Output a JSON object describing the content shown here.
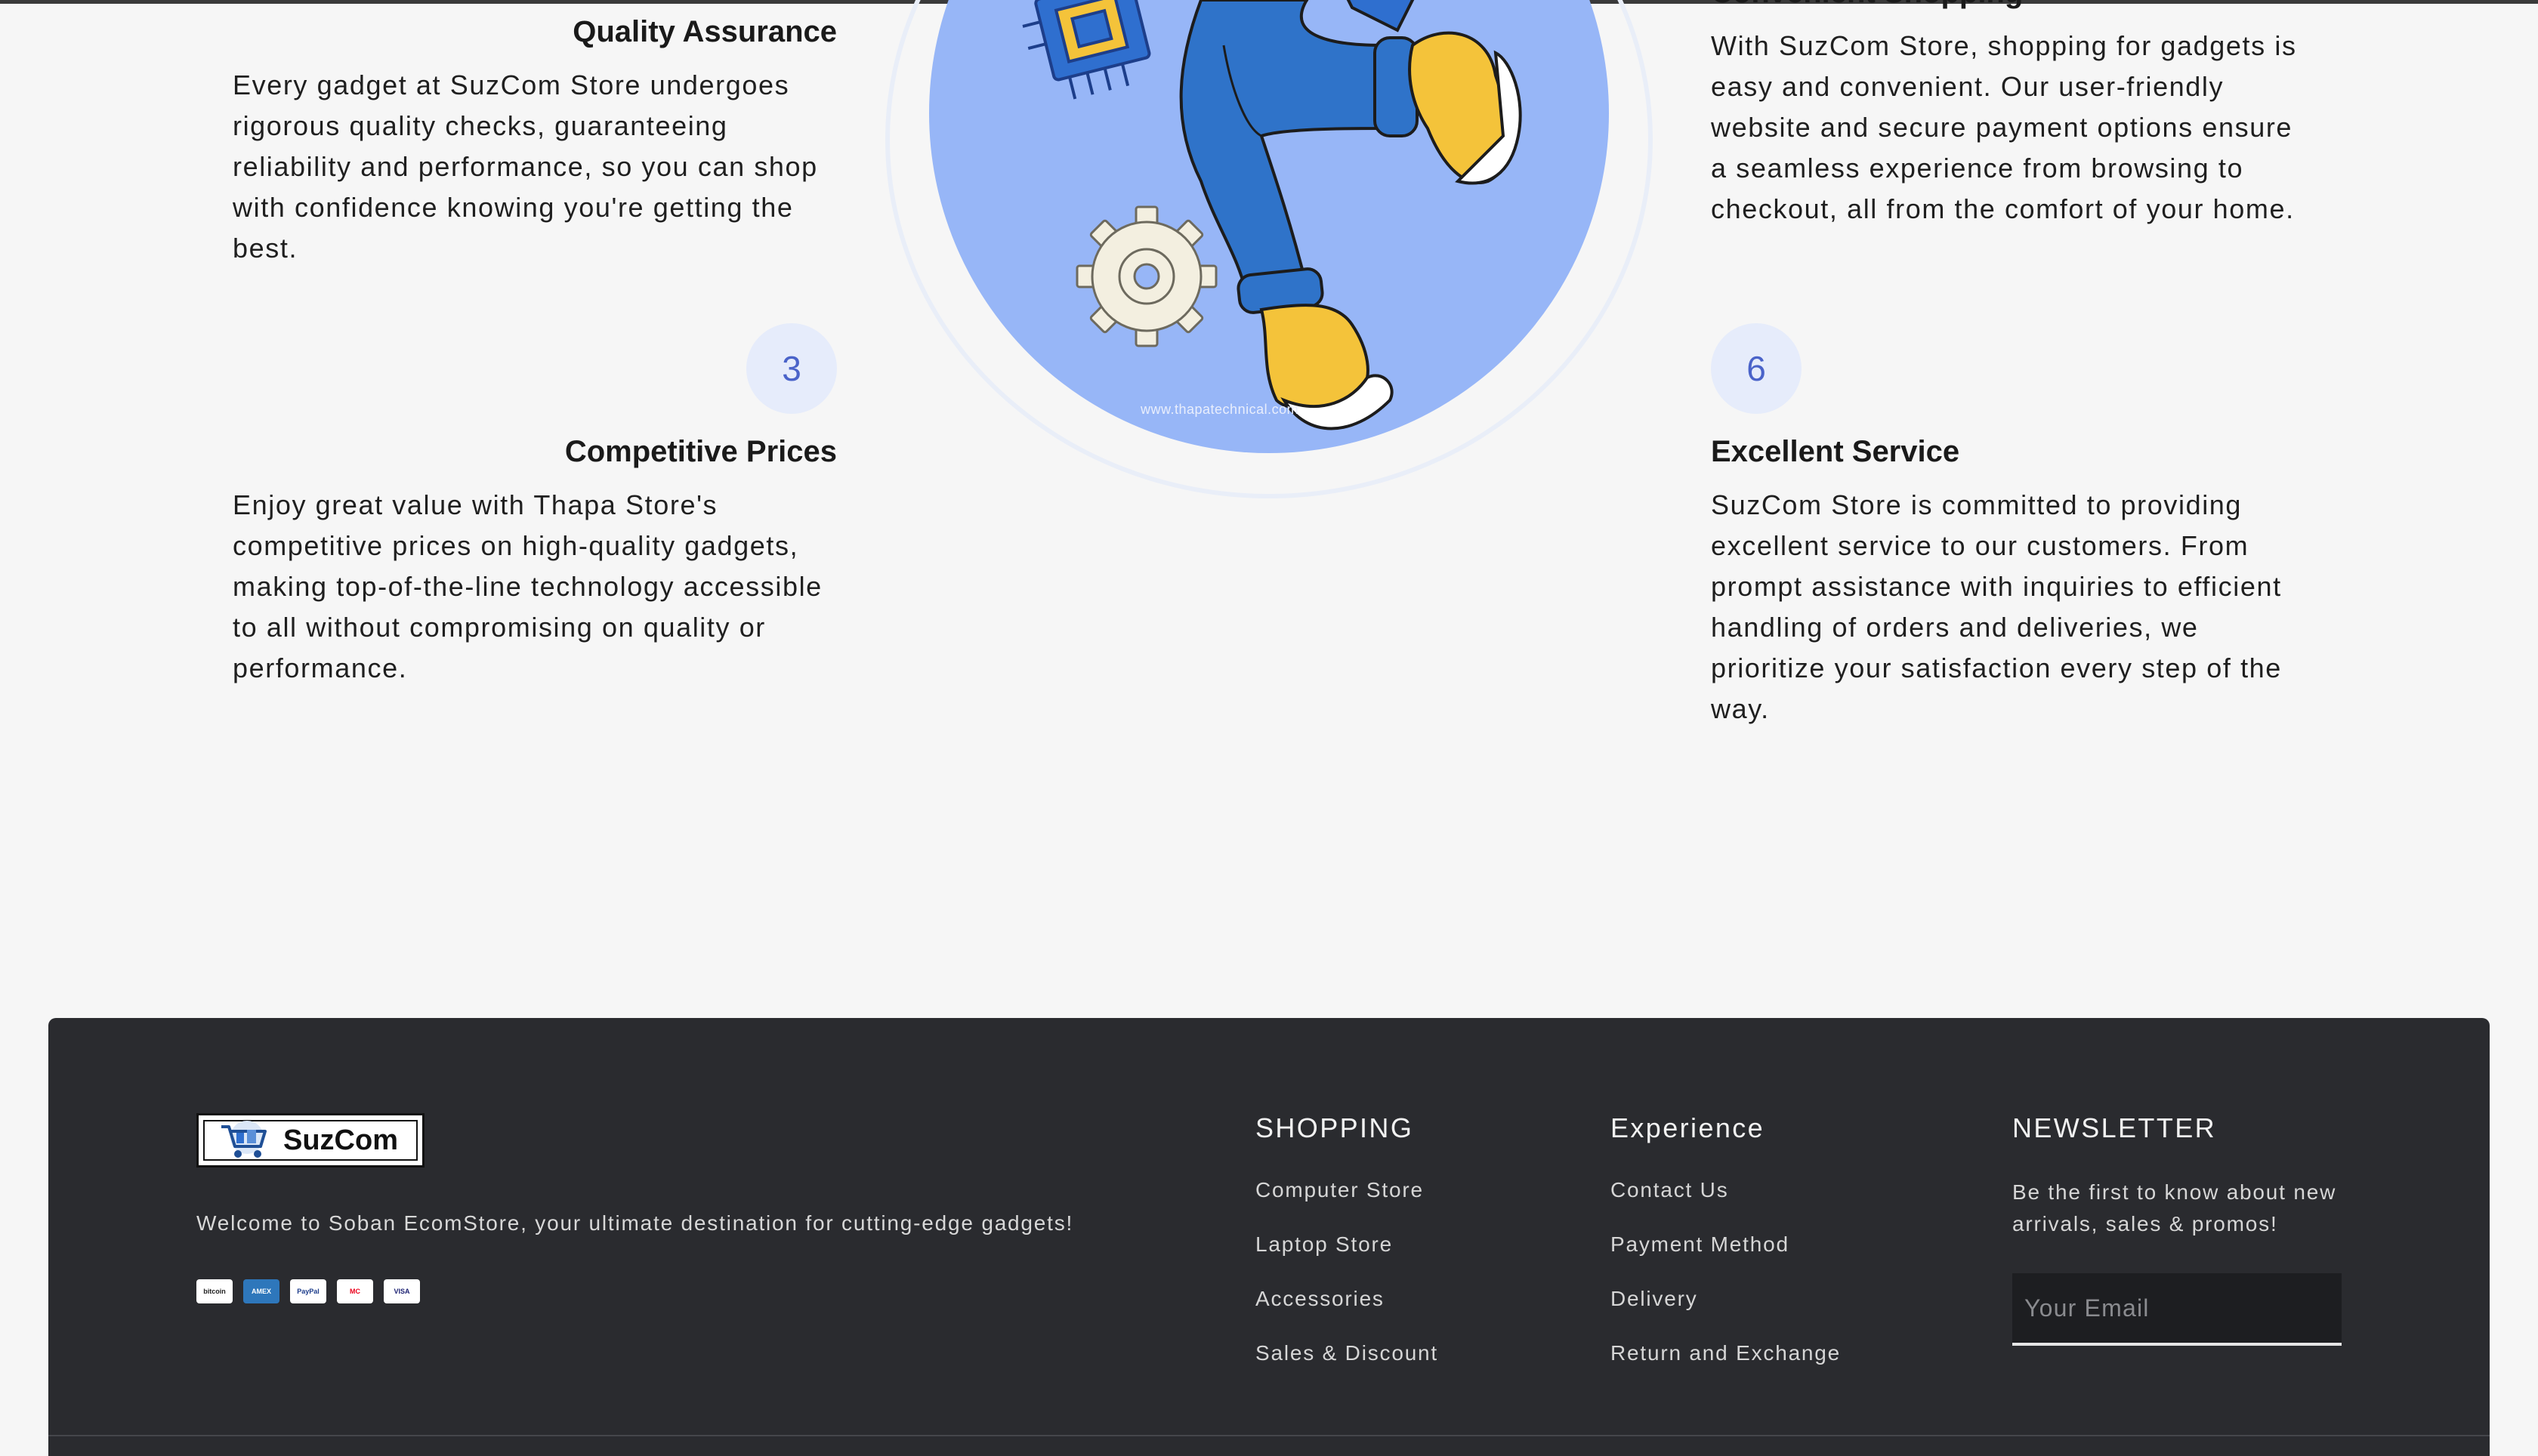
{
  "features": {
    "quality": {
      "title": "Quality Assurance",
      "text": "Every gadget at SuzCom Store undergoes rigorous quality checks, guaranteeing reliability and performance, so you can shop with confidence knowing you're getting the best."
    },
    "prices": {
      "number": "3",
      "title": "Competitive Prices",
      "text": "Enjoy great value with Thapa Store's competitive prices on high-quality gadgets, making top-of-the-line technology accessible to all without compromising on quality or performance."
    },
    "shopping": {
      "title": "Convenient Shopping",
      "text": "With SuzCom Store, shopping for gadgets is easy and convenient. Our user-friendly website and secure payment options ensure a seamless experience from browsing to checkout, all from the comfort of your home."
    },
    "service": {
      "number": "6",
      "title": "Excellent Service",
      "text": "SuzCom Store is committed to providing excellent service to our customers. From prompt assistance with inquiries to efficient handling of orders and deliveries, we prioritize your satisfaction every step of the way."
    }
  },
  "hero": {
    "watermark": "www.thapatechnical.com"
  },
  "footer": {
    "logo_text": "SuzCom",
    "welcome": "Welcome to Soban EcomStore, your ultimate destination for cutting-edge gadgets!",
    "payments": [
      {
        "label": "bitcoin",
        "bg": "#ffffff",
        "color": "#222222"
      },
      {
        "label": "AMEX",
        "bg": "#2e77bb",
        "color": "#ffffff"
      },
      {
        "label": "PayPal",
        "bg": "#ffffff",
        "color": "#1b3b8a"
      },
      {
        "label": "MC",
        "bg": "#ffffff",
        "color": "#eb001b"
      },
      {
        "label": "VISA",
        "bg": "#ffffff",
        "color": "#1a1f71"
      }
    ],
    "shopping": {
      "heading": "SHOPPING",
      "links": [
        "Computer Store",
        "Laptop Store",
        "Accessories",
        "Sales & Discount"
      ]
    },
    "experience": {
      "heading": "Experience",
      "links": [
        "Contact Us",
        "Payment Method",
        "Delivery",
        "Return and Exchange"
      ]
    },
    "newsletter": {
      "heading": "NEWSLETTER",
      "text": "Be the first to know about new arrivals, sales & promos!",
      "placeholder": "Your Email"
    }
  },
  "colors": {
    "accent": "#4a63c9",
    "footer_bg": "#2a2b2f",
    "hero_blue": "#97b6f7"
  }
}
